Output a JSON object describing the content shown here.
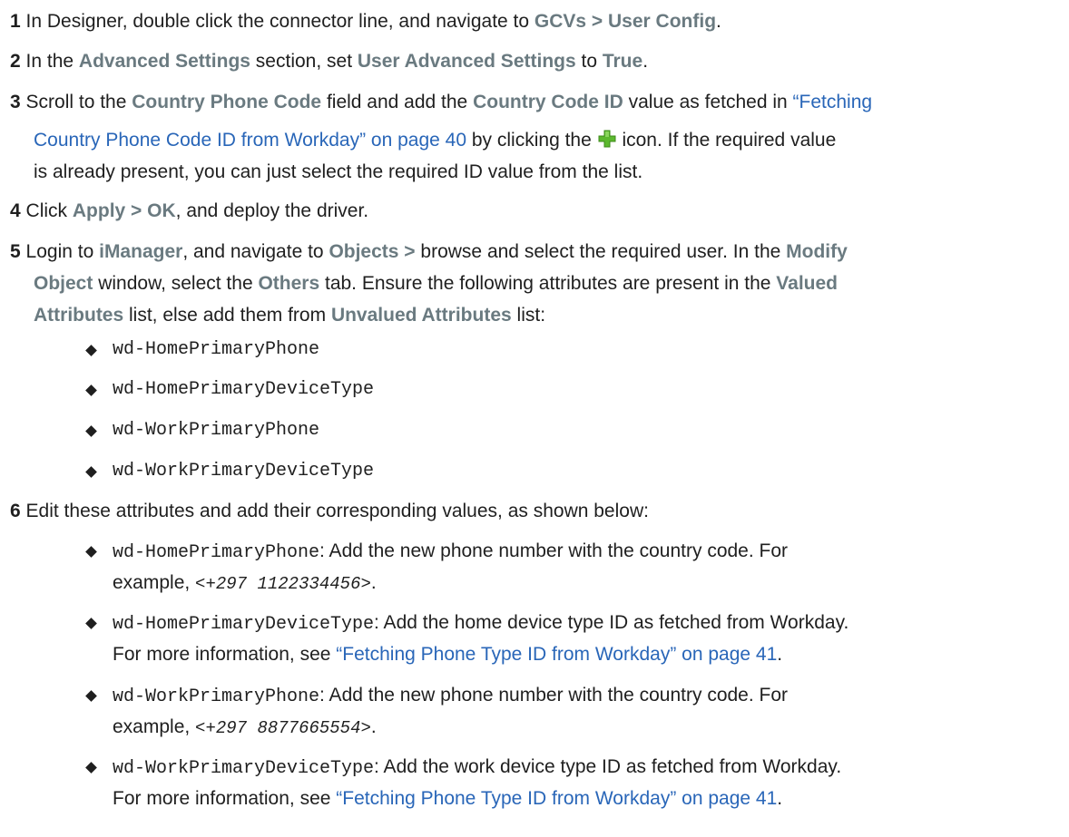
{
  "steps": [
    {
      "number": "1",
      "p1": "In Designer, double click the connector line, and navigate to ",
      "ui1": "GCVs > User Config",
      "p2": "."
    },
    {
      "number": "2",
      "p1": "In the ",
      "ui1": "Advanced Settings",
      "p2": " section, set ",
      "ui2": "User Advanced Settings",
      "p3": " to ",
      "ui3": "True",
      "p4": "."
    },
    {
      "number": "3",
      "p1": "Scroll to the ",
      "ui1": "Country Phone Code",
      "p2": " field and add the ",
      "ui2": "Country Code ID",
      "p3": " value as fetched in ",
      "link1": "“Fetching",
      "link2": "Country Phone Code ID from Workday” on page 40",
      "p4": " by clicking the ",
      "p5": " icon. If the required value",
      "p6": "is already present, you can just select the required ID value from the list."
    },
    {
      "number": "4",
      "p1": "Click ",
      "ui1": "Apply > OK",
      "p2": ", and deploy the driver."
    },
    {
      "number": "5",
      "p1": "Login to ",
      "ui1": "iManager",
      "p2": ", and navigate to ",
      "ui2": "Objects >",
      "p3": " browse and select the required user. In the ",
      "ui3": "Modify",
      "ui4": "Object",
      "p4": " window, select the ",
      "ui5": "Others",
      "p5": " tab. Ensure the following attributes are present in the ",
      "ui6": "Valued",
      "ui7": "Attributes",
      "p6": " list, else add them from ",
      "ui8": "Unvalued Attributes",
      "p7": " list:",
      "bullets": [
        "wd-HomePrimaryPhone",
        "wd-HomePrimaryDeviceType",
        "wd-WorkPrimaryPhone",
        "wd-WorkPrimaryDeviceType"
      ]
    },
    {
      "number": "6",
      "p1": "Edit these attributes and add their corresponding values, as shown below:",
      "items": [
        {
          "attr": "wd-HomePrimaryPhone",
          "text1": ": Add the new phone number with the country code. For",
          "text2": "example, ",
          "example": "<+297 1122334456>",
          "text3": "."
        },
        {
          "attr": "wd-HomePrimaryDeviceType",
          "text1": ": Add the home device type ID as fetched from Workday.",
          "text2": "For more information, see ",
          "link": "“Fetching Phone Type ID from Workday” on page 41",
          "text3": "."
        },
        {
          "attr": "wd-WorkPrimaryPhone",
          "text1": ": Add the new phone number with the country code. For",
          "text2": "example, ",
          "example": "<+297 8877665554>",
          "text3": "."
        },
        {
          "attr": "wd-WorkPrimaryDeviceType",
          "text1": ": Add the work device type ID as fetched from Workday.",
          "text2": "For more information, see ",
          "link": "“Fetching Phone Type ID from Workday” on page 41",
          "text3": "."
        }
      ]
    }
  ],
  "colors": {
    "ui_label": "#6a7a80",
    "link": "#2966b8",
    "icon_green": "#5cb82e"
  },
  "icons": {
    "add_icon": "green-plus-icon"
  }
}
